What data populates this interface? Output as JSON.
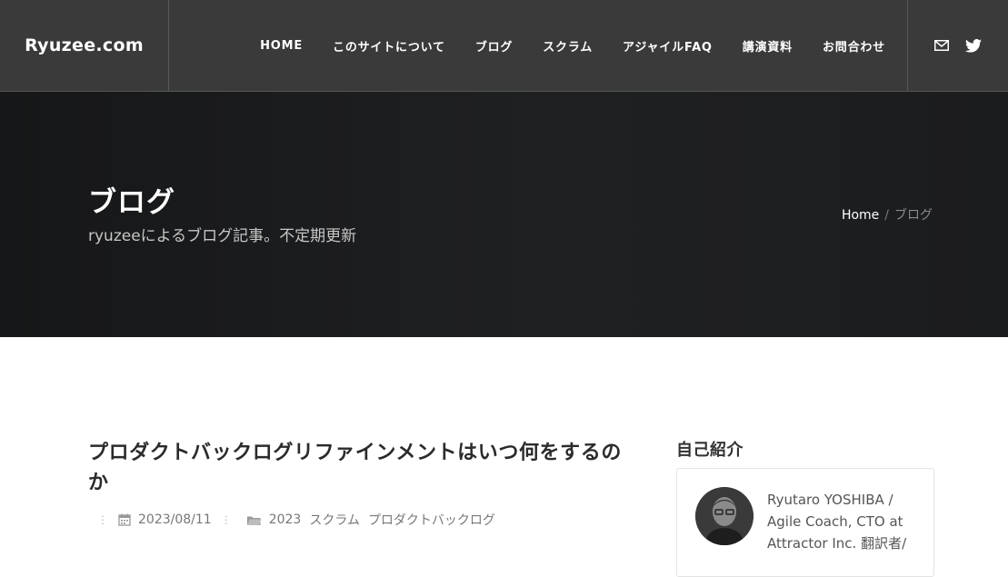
{
  "site": {
    "logo": "Ryuzee.com"
  },
  "nav": {
    "items": [
      {
        "label": "HOME"
      },
      {
        "label": "このサイトについて"
      },
      {
        "label": "ブログ"
      },
      {
        "label": "スクラム"
      },
      {
        "label": "アジャイルFAQ"
      },
      {
        "label": "講演資料"
      },
      {
        "label": "お問合わせ"
      }
    ],
    "social": [
      {
        "icon": "mail-icon"
      },
      {
        "icon": "twitter-icon"
      }
    ]
  },
  "hero": {
    "title": "ブログ",
    "subtitle": "ryuzeeによるブログ記事。不定期更新",
    "breadcrumb": {
      "home": "Home",
      "separator": "/",
      "current": "ブログ"
    }
  },
  "post": {
    "title": "プロダクトバックログリファインメントはいつ何をするのか",
    "date": "2023/08/11",
    "categories": [
      "2023",
      "スクラム",
      "プロダクトバックログ"
    ]
  },
  "sidebar": {
    "title": "自己紹介",
    "bio": "Ryutaro YOSHIBA / Agile Coach, CTO at Attractor Inc. 翻訳者/"
  },
  "colors": {
    "header_bg": "#3a3a3b",
    "hero_bg": "#1c1d1e",
    "text": "#222222"
  }
}
